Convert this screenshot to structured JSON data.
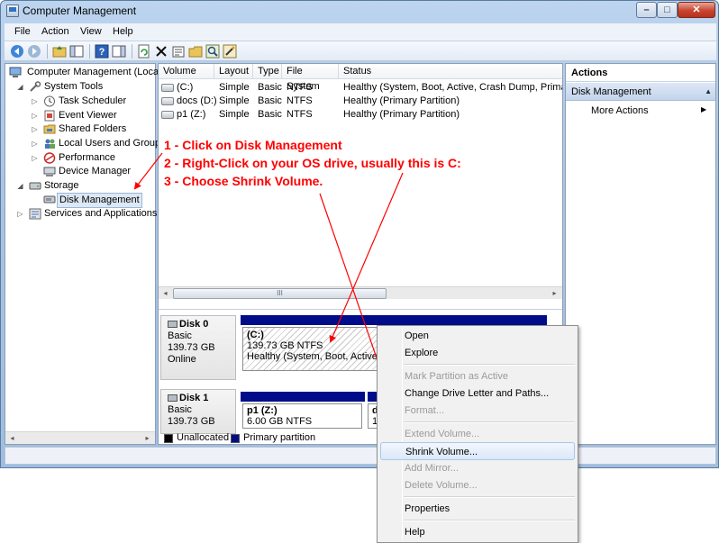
{
  "window": {
    "title": "Computer Management",
    "caption_buttons": {
      "minimize": "–",
      "maximize": "□",
      "close": "✕"
    }
  },
  "menubar": [
    "File",
    "Action",
    "View",
    "Help"
  ],
  "toolbar_icons": [
    "back-arrow-icon",
    "forward-arrow-icon",
    "up-folder-icon",
    "show-hide-tree-icon",
    "help-icon",
    "properties-pane-icon",
    "refresh-icon",
    "delete-icon",
    "properties-icon",
    "open-icon",
    "search-icon",
    "magic-wand-icon"
  ],
  "tree": {
    "root": "Computer Management (Local",
    "system_tools": "System Tools",
    "task_scheduler": "Task Scheduler",
    "event_viewer": "Event Viewer",
    "shared_folders": "Shared Folders",
    "local_users": "Local Users and Groups",
    "performance": "Performance",
    "device_manager": "Device Manager",
    "storage": "Storage",
    "disk_management": "Disk Management",
    "services": "Services and Applications"
  },
  "volume_list": {
    "columns": [
      "Volume",
      "Layout",
      "Type",
      "File System",
      "Status"
    ],
    "rows": [
      {
        "volume": "(C:)",
        "layout": "Simple",
        "type": "Basic",
        "fs": "NTFS",
        "status": "Healthy (System, Boot, Active, Crash Dump, Primary P"
      },
      {
        "volume": "docs (D:)",
        "layout": "Simple",
        "type": "Basic",
        "fs": "NTFS",
        "status": "Healthy (Primary Partition)"
      },
      {
        "volume": "p1 (Z:)",
        "layout": "Simple",
        "type": "Basic",
        "fs": "NTFS",
        "status": "Healthy (Primary Partition)"
      }
    ],
    "scroll_left": "◂",
    "scroll_right": "▸",
    "scroll_thumb_grip": "III"
  },
  "disks": [
    {
      "name": "Disk 0",
      "type": "Basic",
      "size": "139.73 GB",
      "state": "Online",
      "partition": {
        "label": "(C:)",
        "size": "139.73 GB NTFS",
        "status": "Healthy (System, Boot, Active, C"
      }
    },
    {
      "name": "Disk 1",
      "type": "Basic",
      "size": "139.73 GB",
      "state": "",
      "partition": {
        "label": "p1  (Z:)",
        "size": "6.00 GB NTFS"
      },
      "partition2": {
        "label": "d",
        "size": "13"
      }
    }
  ],
  "legend": {
    "unallocated": "Unallocated",
    "primary": "Primary partition"
  },
  "actions": {
    "title": "Actions",
    "section": "Disk Management",
    "collapse_glyph": "▲",
    "more": "More Actions",
    "more_arrow": "▶"
  },
  "annotations": {
    "step1": "1 - Click on Disk Management",
    "step2": "2 - Right-Click on your OS drive, usually this is C:",
    "step3": "3 - Choose Shrink Volume."
  },
  "context_menu": {
    "open": "Open",
    "explore": "Explore",
    "mark_active": "Mark Partition as Active",
    "change_letter": "Change Drive Letter and Paths...",
    "format": "Format...",
    "extend": "Extend Volume...",
    "shrink": "Shrink Volume...",
    "add_mirror": "Add Mirror...",
    "delete": "Delete Volume...",
    "properties": "Properties",
    "help": "Help"
  },
  "colors": {
    "annotation": "#ff0000",
    "primary_partition": "#000d8a",
    "window_frame": "#a9c4e4"
  }
}
